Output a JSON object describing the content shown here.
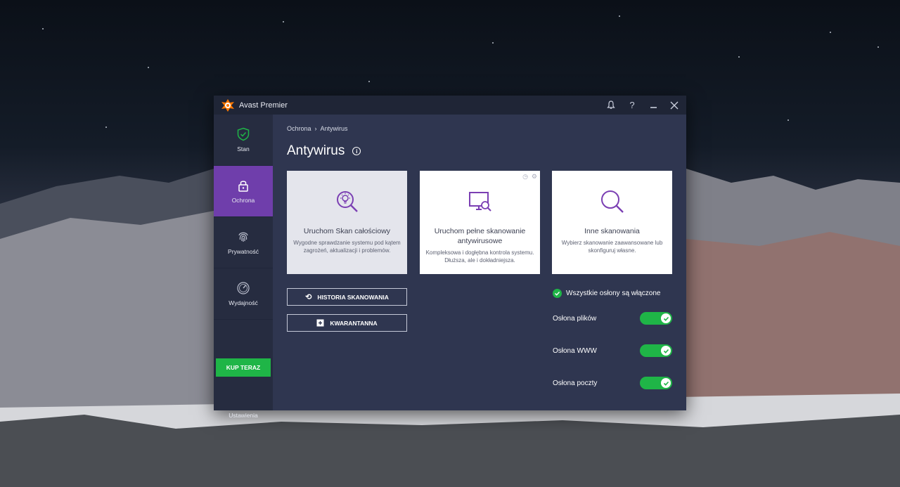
{
  "app": {
    "title": "Avast Premier",
    "accent_color": "#6f3eab",
    "success_color": "#1fb547"
  },
  "titlebar": {
    "icons": [
      "bell-icon",
      "help-icon",
      "minimize-icon",
      "close-icon"
    ],
    "help_label": "?"
  },
  "sidebar": {
    "items": [
      {
        "label": "Stan",
        "icon": "shield-check-icon",
        "active": false
      },
      {
        "label": "Ochrona",
        "icon": "lock-icon",
        "active": true
      },
      {
        "label": "Prywatność",
        "icon": "fingerprint-icon",
        "active": false
      },
      {
        "label": "Wydajność",
        "icon": "speedometer-icon",
        "active": false
      }
    ],
    "buy_label": "KUP TERAZ",
    "settings_label": "Ustawienia"
  },
  "main": {
    "breadcrumb": [
      "Ochrona",
      "Antywirus"
    ],
    "breadcrumb_sep": "›",
    "title": "Antywirus",
    "cards": [
      {
        "title": "Uruchom Skan całościowy",
        "desc": "Wygodne sprawdzanie systemu pod kątem zagrożeń, aktualizacji i problemów.",
        "icon": "smart-scan-icon"
      },
      {
        "title": "Uruchom pełne skanowanie antywirusowe",
        "desc": "Kompleksowa i dogłębna kontrola systemu. Dłuższa, ale i dokładniejsza.",
        "icon": "monitor-scan-icon"
      },
      {
        "title": "Inne skanowania",
        "desc": "Wybierz skanowanie zaawansowane lub skonfiguruj własne.",
        "icon": "magnifier-icon"
      }
    ],
    "buttons": {
      "history": "HISTORIA SKANOWANIA",
      "quarantine": "KWARANTANNA"
    },
    "status": "Wszystkie osłony są włączone",
    "shields": [
      {
        "label": "Osłona plików",
        "enabled": true
      },
      {
        "label": "Osłona WWW",
        "enabled": true
      },
      {
        "label": "Osłona poczty",
        "enabled": true
      }
    ]
  }
}
